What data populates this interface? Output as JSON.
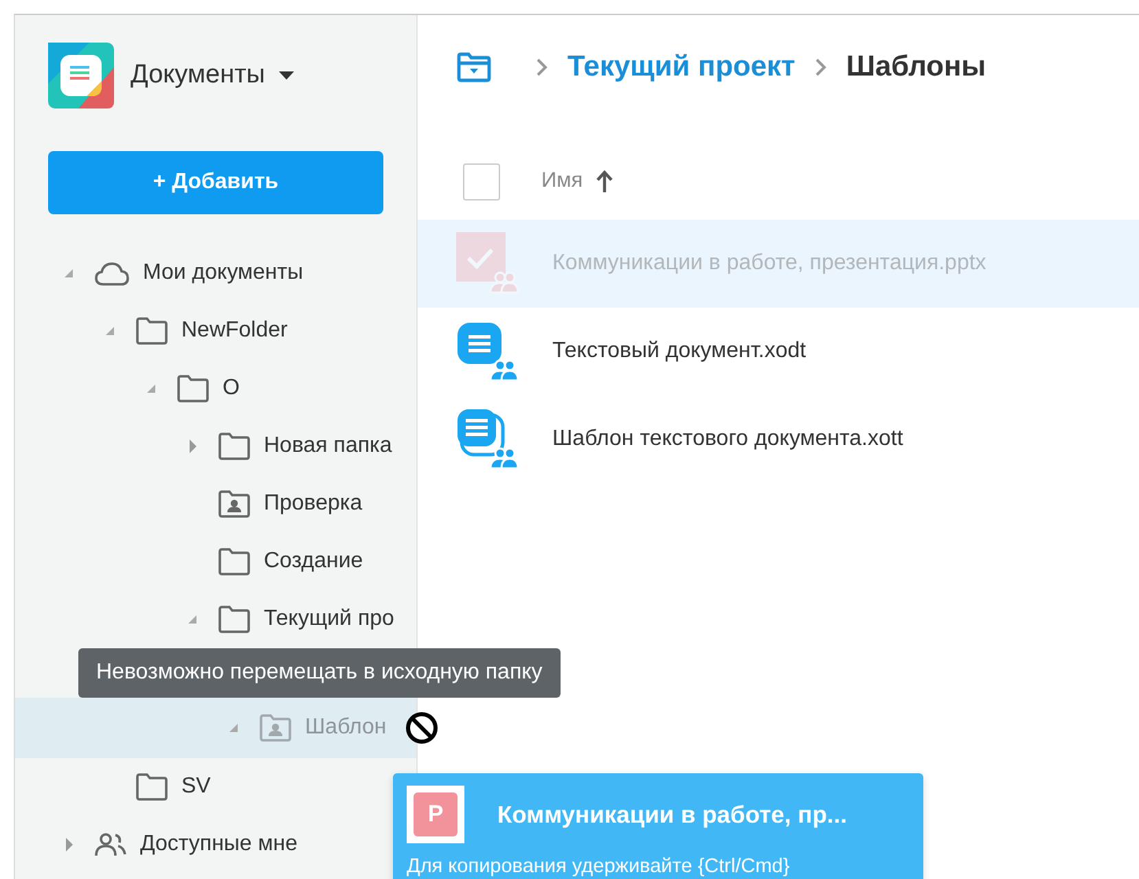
{
  "app": {
    "title": "Документы",
    "add_button": "+ Добавить"
  },
  "tree": [
    {
      "label": "Мои документы",
      "kind": "cloud",
      "has_children": true,
      "expanded": true,
      "selected": false,
      "disabled": false,
      "children": [
        {
          "label": "NewFolder",
          "kind": "folder",
          "has_children": true,
          "expanded": true,
          "selected": false,
          "disabled": false,
          "children": [
            {
              "label": "О",
              "kind": "folder",
              "has_children": true,
              "expanded": true,
              "selected": false,
              "disabled": false,
              "children": [
                {
                  "label": "Новая папка",
                  "kind": "folder",
                  "has_children": true,
                  "expanded": false,
                  "selected": false,
                  "disabled": false
                },
                {
                  "label": "Проверка",
                  "kind": "shared",
                  "has_children": false,
                  "selected": false,
                  "disabled": false
                },
                {
                  "label": "Создание",
                  "kind": "folder",
                  "has_children": false,
                  "selected": false,
                  "disabled": false
                },
                {
                  "label": "Текущий про",
                  "kind": "folder",
                  "has_children": true,
                  "expanded": true,
                  "selected": false,
                  "disabled": false,
                  "children": [
                    {
                      "label": "Шаблон",
                      "kind": "shared",
                      "has_children": true,
                      "expanded": true,
                      "selected": true,
                      "disabled": true
                    }
                  ]
                }
              ]
            }
          ]
        },
        {
          "label": "SV",
          "kind": "folder",
          "has_children": false,
          "selected": false,
          "disabled": false
        }
      ]
    },
    {
      "label": "Доступные мне",
      "kind": "people",
      "has_children": true,
      "expanded": false,
      "selected": false,
      "disabled": false
    }
  ],
  "breadcrumb": {
    "items": [
      {
        "label": "Текущий проект",
        "current": false
      },
      {
        "label": "Шаблоны",
        "current": true
      }
    ]
  },
  "table": {
    "header": {
      "label": "Имя",
      "checked": false
    },
    "rows": [
      {
        "name": "Коммуникации в работе, презентация.pptx",
        "kind": "presentation",
        "selected": true,
        "dimmed": true
      },
      {
        "name": "Текстовый документ.xodt",
        "kind": "document",
        "selected": false,
        "dimmed": false
      },
      {
        "name": "Шаблон текстового документа.xott",
        "kind": "template",
        "selected": false,
        "dimmed": false
      }
    ]
  },
  "tooltip": "Невозможно перемещать в исходную папку",
  "drag": {
    "badge": "P",
    "title": "Коммуникации в работе, пр...",
    "hint": "Для копирования удерживайте {Ctrl/Cmd}"
  }
}
